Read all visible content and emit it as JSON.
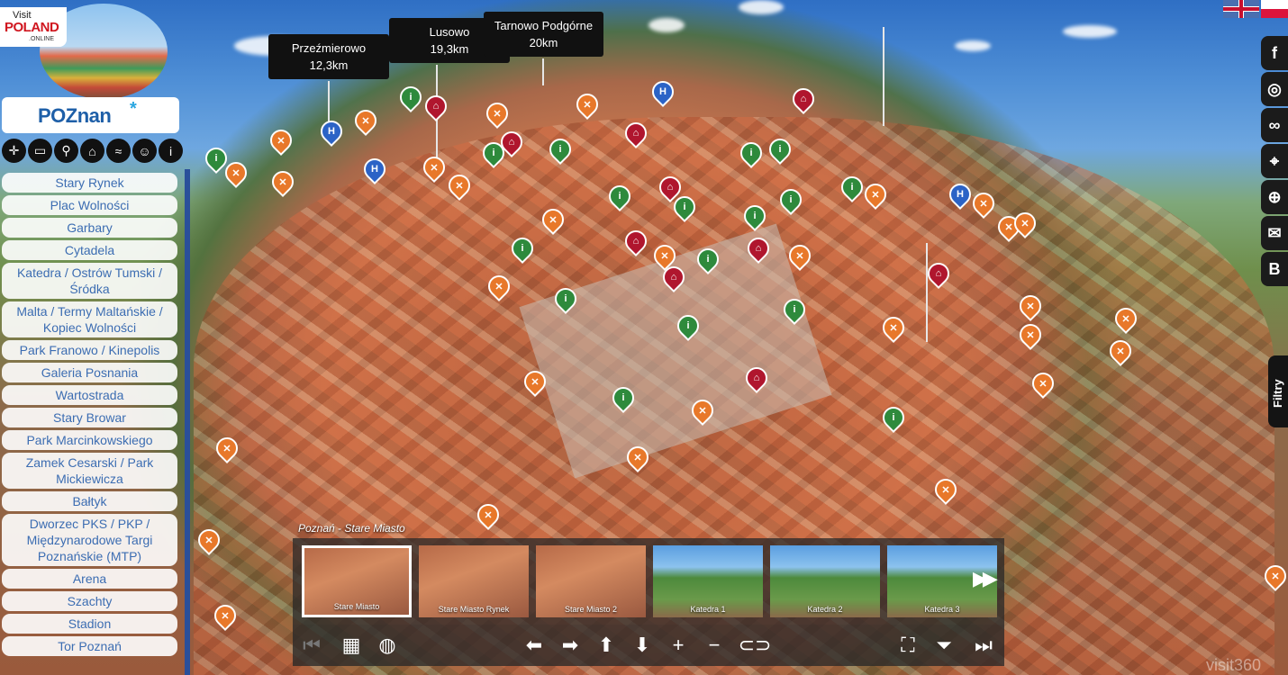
{
  "brand": {
    "visit_small": "Visit",
    "visit_big": "POLAND",
    "visit_suffix": ".ONLINE",
    "city_logo": "POZnan",
    "city_logo_star": "*"
  },
  "categories": [
    {
      "icon": "directions-icon",
      "glyph": "✛"
    },
    {
      "icon": "bed-icon",
      "glyph": "▭"
    },
    {
      "icon": "restaurant-icon",
      "glyph": "⚲"
    },
    {
      "icon": "museum-icon",
      "glyph": "⌂"
    },
    {
      "icon": "pool-icon",
      "glyph": "≈"
    },
    {
      "icon": "theater-icon",
      "glyph": "☺"
    },
    {
      "icon": "info-icon",
      "glyph": "i"
    }
  ],
  "nav": [
    "Stary Rynek",
    "Plac Wolności",
    "Garbary",
    "Cytadela",
    "Katedra / Ostrów Tumski / Śródka",
    "Malta / Termy Maltańskie / Kopiec Wolności",
    "Park Franowo / Kinepolis",
    "Galeria Posnania",
    "Wartostrada",
    "Stary Browar",
    "Park Marcinkowskiego",
    "Zamek Cesarski / Park Mickiewicza",
    "Bałtyk",
    "Dworzec PKS / PKP / Międzynarodowe Targi Poznańskie (MTP)",
    "Arena",
    "Szachty",
    "Stadion",
    "Tor Poznań"
  ],
  "distance_labels": [
    {
      "name": "Przeźmierowo",
      "distance": "12,3km"
    },
    {
      "name": "Lusowo",
      "distance": "19,3km"
    },
    {
      "name": "Tarnowo Podgórne",
      "distance": "20km"
    }
  ],
  "social": [
    "f",
    "◎",
    "∞",
    "⌖",
    "⊕",
    "✉",
    "B"
  ],
  "filters_label": "Filtry",
  "scene": {
    "current_title": "Poznań - Stare Miasto"
  },
  "thumbnails": [
    {
      "label": "Stare Miasto",
      "active": true
    },
    {
      "label": "Stare Miasto Rynek",
      "active": false
    },
    {
      "label": "Stare Miasto 2",
      "active": false
    },
    {
      "label": "Katedra 1",
      "active": false
    },
    {
      "label": "Katedra 2",
      "active": false
    },
    {
      "label": "Katedra 3",
      "active": false
    }
  ],
  "toolbar": {
    "prev": "⏮",
    "grid": "▦",
    "globe": "◍",
    "left": "⬅",
    "right": "➡",
    "up": "⬆",
    "down": "⬇",
    "zoom_in": "+",
    "zoom_out": "−",
    "vr": "⊂⊃",
    "fullscreen": "⛶",
    "hide": "⏷",
    "next": "⏭"
  },
  "watermark": "visit360"
}
